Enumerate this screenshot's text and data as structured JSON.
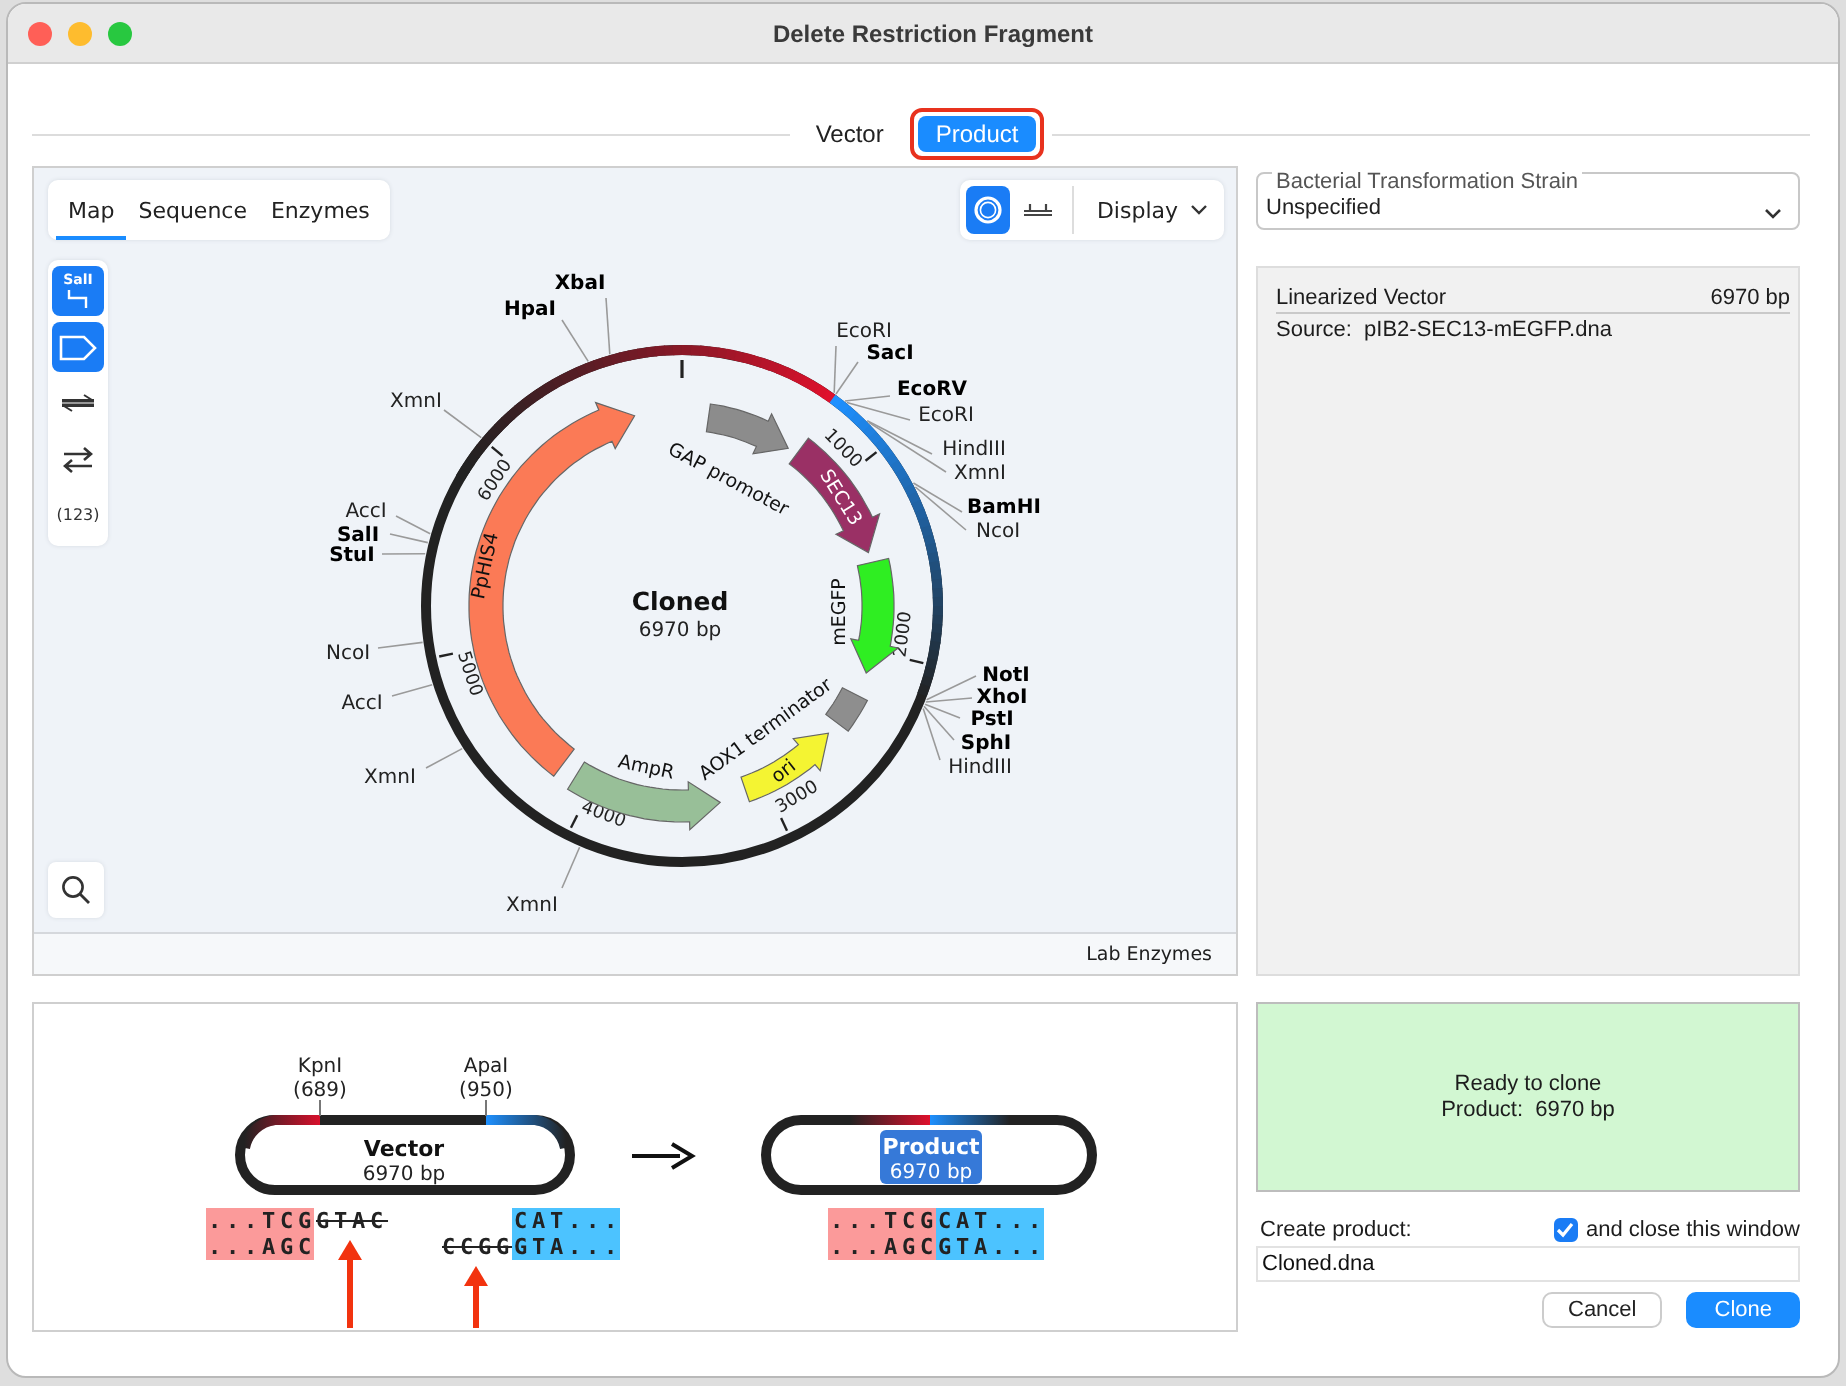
{
  "window": {
    "title": "Delete Restriction Fragment"
  },
  "view_switch": [
    {
      "label": "Vector",
      "selected": false,
      "highlighted": false
    },
    {
      "label": "Product",
      "selected": true,
      "highlighted": true
    }
  ],
  "map_tabs": [
    {
      "label": "Map",
      "selected": true
    },
    {
      "label": "Sequence",
      "selected": false
    },
    {
      "label": "Enzymes",
      "selected": false
    }
  ],
  "map_tools": [
    {
      "kind": "enzymes",
      "label": "SalI",
      "on": true
    },
    {
      "kind": "features",
      "on": true
    },
    {
      "kind": "strands",
      "on": false
    },
    {
      "kind": "translations",
      "on": false
    },
    {
      "kind": "numbers",
      "label": "(123)",
      "on": false
    }
  ],
  "view_buttons": [
    {
      "kind": "circular",
      "selected": true
    },
    {
      "kind": "linear",
      "selected": false
    }
  ],
  "display_menu": "Display",
  "map": {
    "name": "Cloned",
    "length": "6970 bp",
    "ticks": [
      "1000",
      "2000",
      "3000",
      "4000",
      "5000",
      "6000"
    ],
    "features": [
      {
        "label": "PpHIS4",
        "color": "#fb7a56"
      },
      {
        "label": "GAP promoter",
        "color": "#8c8c8c"
      },
      {
        "label": "SEC13",
        "color": "#9a3065"
      },
      {
        "label": "mEGFP",
        "color": "#2fee22"
      },
      {
        "label": "AOX1 terminator",
        "color": "#8e8e8e"
      },
      {
        "label": "ori",
        "color": "#f4f432"
      },
      {
        "label": "AmpR",
        "color": "#98bf98"
      }
    ],
    "enzymes": [
      {
        "name": "XbaI",
        "unique": true
      },
      {
        "name": "HpaI",
        "unique": true
      },
      {
        "name": "EcoRI",
        "unique": false
      },
      {
        "name": "SacI",
        "unique": true
      },
      {
        "name": "EcoRV",
        "unique": true
      },
      {
        "name": "XmnI",
        "unique": false
      },
      {
        "name": "EcoRI",
        "unique": false
      },
      {
        "name": "HindIII",
        "unique": false
      },
      {
        "name": "XmnI",
        "unique": false
      },
      {
        "name": "BamHI",
        "unique": true
      },
      {
        "name": "AccI",
        "unique": false
      },
      {
        "name": "NcoI",
        "unique": false
      },
      {
        "name": "SalI",
        "unique": true
      },
      {
        "name": "StuI",
        "unique": true
      },
      {
        "name": "NcoI",
        "unique": false
      },
      {
        "name": "NotI",
        "unique": true
      },
      {
        "name": "XhoI",
        "unique": true
      },
      {
        "name": "AccI",
        "unique": false
      },
      {
        "name": "PstI",
        "unique": true
      },
      {
        "name": "SphI",
        "unique": true
      },
      {
        "name": "HindIII",
        "unique": false
      },
      {
        "name": "XmnI",
        "unique": false
      },
      {
        "name": "XmnI",
        "unique": false
      }
    ]
  },
  "enzyme_set": "Lab Enzymes",
  "fragment": {
    "vector": {
      "label": "Vector",
      "length": "6970 bp",
      "sites": [
        {
          "name": "KpnI",
          "position": "(689)"
        },
        {
          "name": "ApaI",
          "position": "(950)"
        }
      ],
      "rows": [
        {
          "left": [
            {
              "text": "...TCG",
              "kind": "kept"
            },
            {
              "text": "GTAC",
              "kind": "removed"
            }
          ],
          "right": [
            {
              "text": "CAT...",
              "kind": "kept"
            }
          ]
        },
        {
          "left": [
            {
              "text": "...AGC",
              "kind": "kept"
            }
          ],
          "right": [
            {
              "text": "CCGG",
              "kind": "removed"
            },
            {
              "text": "GTA...",
              "kind": "kept"
            }
          ]
        }
      ]
    },
    "product": {
      "label": "Product",
      "length": "6970 bp",
      "rows": [
        {
          "left": [
            {
              "text": "...TCG",
              "kind": "kept"
            }
          ],
          "right": [
            {
              "text": "CAT...",
              "kind": "kept"
            }
          ]
        },
        {
          "left": [
            {
              "text": "...AGC",
              "kind": "kept"
            }
          ],
          "right": [
            {
              "text": "GTA...",
              "kind": "kept"
            }
          ]
        }
      ]
    }
  },
  "strain": {
    "label": "Bacterial Transformation Strain",
    "value": "Unspecified"
  },
  "info": {
    "title": "Linearized Vector",
    "length": "6970 bp",
    "source": "Source:  pIB2-SEC13-mEGFP.dna"
  },
  "status": {
    "lines": [
      "Ready to clone",
      "Product:  6970 bp"
    ]
  },
  "create": {
    "label": "Create product:",
    "close_checked": true,
    "close_label": "and close this window",
    "filename": "Cloned.dna"
  },
  "buttons": [
    {
      "label": "Cancel",
      "kind": "secondary"
    },
    {
      "label": "Clone",
      "kind": "primary"
    }
  ]
}
